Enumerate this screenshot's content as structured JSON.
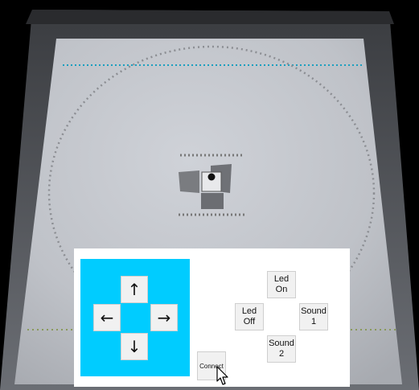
{
  "controls": {
    "up": "↑",
    "left": "←",
    "right": "→",
    "down": "↓",
    "led_on": "Led\nOn",
    "led_off": "Led\nOff",
    "sound_1": "Sound\n1",
    "sound_2": "Sound\n2",
    "connect": "Connect"
  },
  "colors": {
    "dpad_background": "#00ccff",
    "panel_background": "#ffffff",
    "arena_floor": "#bfc2c8",
    "arena_border_dots": "#1aa0c0"
  }
}
